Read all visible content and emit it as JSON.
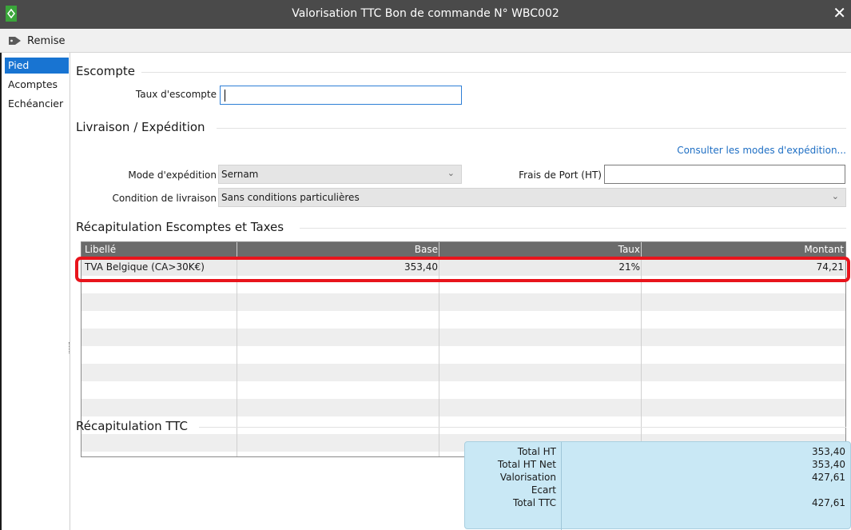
{
  "window": {
    "title": "Valorisation TTC Bon de commande N° WBC002"
  },
  "toolbar": {
    "remise_label": "Remise"
  },
  "sidebar": {
    "items": [
      {
        "label": "Pied",
        "active": true
      },
      {
        "label": "Acomptes",
        "active": false
      },
      {
        "label": "Echéancier",
        "active": false
      }
    ]
  },
  "escompte": {
    "title": "Escompte",
    "taux_label": "Taux d'escompte",
    "taux_value": ""
  },
  "livraison": {
    "title": "Livraison / Expédition",
    "consult_link": "Consulter les modes d'expédition...",
    "mode_label": "Mode d'expédition",
    "mode_value": "Sernam",
    "frais_label": "Frais de Port (HT)",
    "frais_value": "",
    "condition_label": "Condition de livraison",
    "condition_value": "Sans conditions particulières"
  },
  "recap_taxes": {
    "title": "Récapitulation Escomptes et Taxes",
    "columns": [
      "Libellé",
      "Base",
      "Taux",
      "Montant"
    ],
    "rows": [
      {
        "libelle": "TVA Belgique (CA>30K€)",
        "base": "353,40",
        "taux": "21%",
        "montant": "74,21"
      }
    ]
  },
  "recap_ttc": {
    "title": "Récapitulation TTC",
    "rows": [
      {
        "label": "Total HT",
        "value": "353,40"
      },
      {
        "label": "Total HT Net",
        "value": "353,40"
      },
      {
        "label": "Valorisation",
        "value": "427,61"
      },
      {
        "label": "Ecart",
        "value": ""
      },
      {
        "label": "Total TTC",
        "value": "427,61"
      }
    ]
  },
  "colors": {
    "titlebar": "#4a4a4a",
    "accent": "#1874d2",
    "highlight": "#e8141c",
    "recap_bg": "#c9e8f5",
    "link": "#1f6fc4"
  },
  "icons": {
    "app": "app-logo-icon",
    "remise": "tag-icon",
    "close": "close-icon",
    "dropdown": "chevron-down-icon"
  }
}
